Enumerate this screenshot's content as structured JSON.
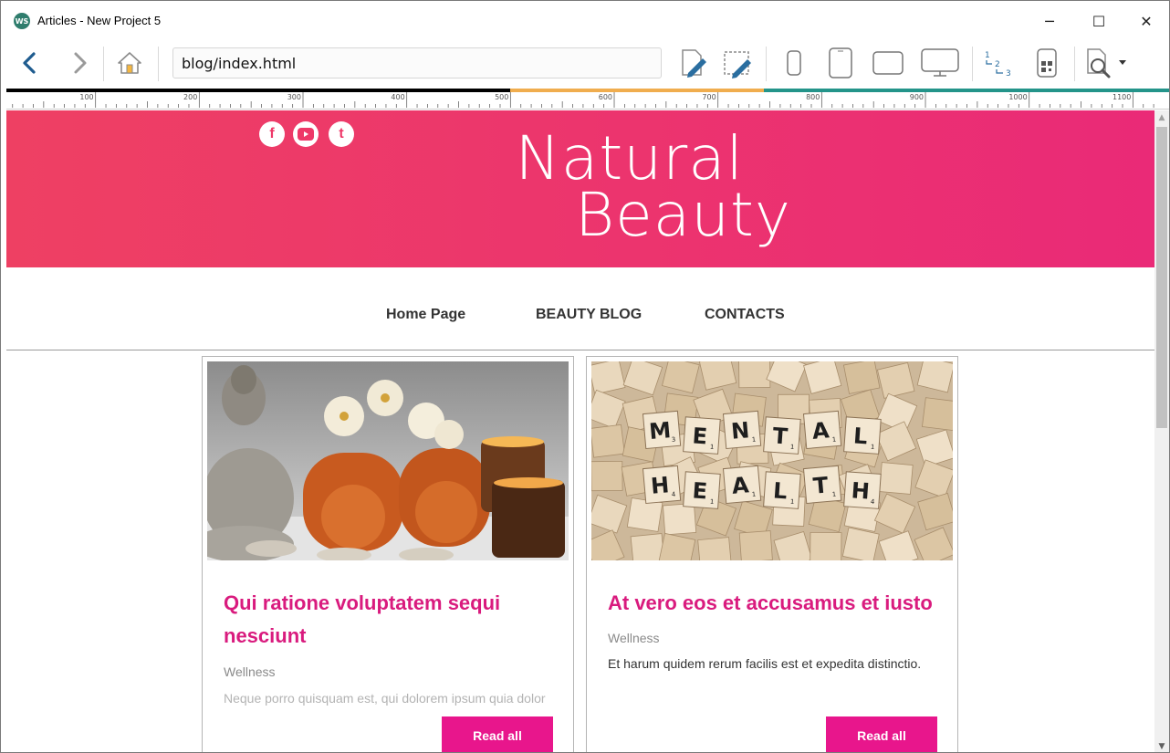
{
  "window": {
    "app_icon_text": "WS",
    "title": "Articles - New Project 5",
    "controls": {
      "minimize": "─",
      "maximize": "☐",
      "close": "✕"
    }
  },
  "toolbar": {
    "url": "blog/index.html",
    "icons": [
      "back-icon",
      "forward-icon",
      "home-icon",
      "edit-page-icon",
      "edit-selection-icon",
      "phone-portrait-icon",
      "tablet-portrait-icon",
      "tablet-landscape-icon",
      "desktop-icon",
      "numbering-icon",
      "qr-preview-icon",
      "preview-search-icon",
      "dropdown-caret-icon"
    ]
  },
  "ruler": {
    "labels": [
      "100",
      "200",
      "300",
      "400",
      "500",
      "600",
      "700",
      "800",
      "900",
      "1000",
      "1100"
    ]
  },
  "site": {
    "hero": {
      "title_line1": "Natural",
      "title_line2": "Beauty",
      "social": {
        "facebook": "f",
        "youtube": "▶",
        "twitter": "t"
      }
    },
    "nav": [
      {
        "label": "Home Page"
      },
      {
        "label": "BEAUTY BLOG"
      },
      {
        "label": "CONTACTS"
      }
    ],
    "articles": [
      {
        "title": "Qui ratione voluptatem sequi nesciunt",
        "category": "Wellness",
        "excerpt": "Neque porro quisquam est, qui dolorem ipsum quia dolor",
        "button": "Read all"
      },
      {
        "title": "At vero eos et accusamus et iusto",
        "category": "Wellness",
        "excerpt": "Et harum quidem rerum facilis est et expedita distinctio.",
        "button": "Read all"
      }
    ],
    "tiles": {
      "row1": [
        "M",
        "E",
        "N",
        "T",
        "A",
        "L"
      ],
      "row1_sub": [
        "3",
        "1",
        "1",
        "1",
        "1",
        "1"
      ],
      "row2": [
        "H",
        "E",
        "A",
        "L",
        "T",
        "H"
      ],
      "row2_sub": [
        "4",
        "1",
        "1",
        "1",
        "1",
        "4"
      ]
    }
  },
  "colors": {
    "accent": "#e8168c",
    "title_pink": "#d91b7e",
    "hero_start": "#ee4063",
    "hero_end": "#ea2a77",
    "back_arrow": "#1f5c8f"
  }
}
